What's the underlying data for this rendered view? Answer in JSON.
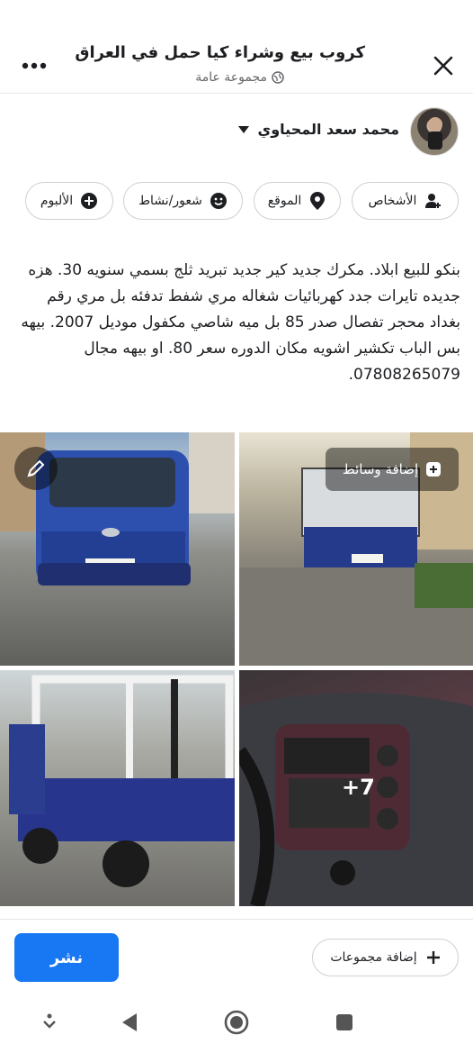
{
  "header": {
    "title": "كروب بيع وشراء كيا حمل في العراق",
    "subtitle": "مجموعة عامة",
    "close_icon": "close-icon",
    "more_icon": "more-icon"
  },
  "author": {
    "name": "محمد سعد المحياوي"
  },
  "chips": {
    "people": "الأشخاص",
    "location": "الموقع",
    "feeling": "شعور/نشاط",
    "album": "الألبوم"
  },
  "post": {
    "text": "بنكو للبيع  ابلاد. مكرك جديد كير جديد تبريد ثلج بسمي سنويه 30. هزه جديده تايرات جدد كهربائيات شغاله مري شفط تدفئه بل مري رقم بغداد محجر تفصال صدر 85 بل ميه  شاصي مكفول موديل 2007.  بيهه  بس الباب تكشير  اشويه  مكان الدوره سعر 80. او بيهه  مجال  07808265079."
  },
  "media": {
    "add_media_label": "إضافة وسائط",
    "more_count": "+7"
  },
  "actions": {
    "publish_label": "نشر",
    "add_groups_label": "إضافة مجموعات"
  },
  "colors": {
    "primary": "#1877f2",
    "text": "#1c1e21",
    "muted": "#65676b",
    "border": "#ced0d4"
  }
}
